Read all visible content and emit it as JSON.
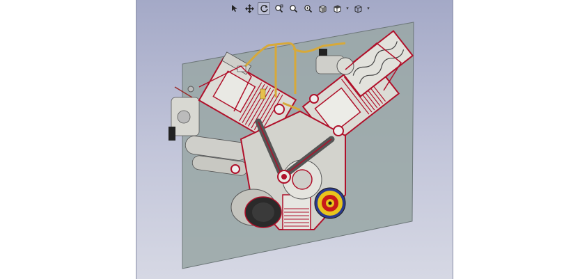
{
  "app": {
    "title": ""
  },
  "toolbar": {
    "active_tool": "rotate",
    "tools": [
      {
        "name": "select",
        "icon": "cursor-arrow-icon"
      },
      {
        "name": "pan",
        "icon": "move-arrows-icon"
      },
      {
        "name": "rotate",
        "icon": "rotate-icon"
      },
      {
        "name": "zoom-window",
        "icon": "zoom-window-icon"
      },
      {
        "name": "zoom",
        "icon": "zoom-icon"
      },
      {
        "name": "zoom-fit",
        "icon": "zoom-fit-icon"
      },
      {
        "name": "shaded",
        "icon": "shaded-cube-icon"
      },
      {
        "name": "view-orientation",
        "icon": "view-cube-icon"
      },
      {
        "name": "wireframe",
        "icon": "wireframe-cube-icon"
      }
    ]
  },
  "model": {
    "description_icon": "v-engine-section-model",
    "colors": {
      "section_plane": "#9aa7a6",
      "body": "#d9d9d4",
      "cut_edge": "#b0102a",
      "pipe": "#d7a93a",
      "pulley_red": "#c81a1a",
      "pulley_blue": "#2a3a8e",
      "pulley_yellow": "#e8c51d"
    }
  }
}
